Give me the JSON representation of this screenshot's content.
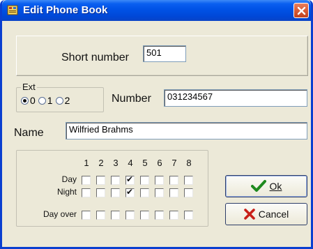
{
  "window": {
    "title": "Edit Phone Book",
    "icon": "phonebook-icon",
    "close_icon": "close-icon"
  },
  "short_number": {
    "label": "Short number",
    "value": "501"
  },
  "ext": {
    "legend": "Ext",
    "options": [
      {
        "label": "0",
        "checked": true
      },
      {
        "label": "1",
        "checked": false
      },
      {
        "label": "2",
        "checked": false
      }
    ]
  },
  "number": {
    "label": "Number",
    "value": "031234567"
  },
  "name": {
    "label": "Name",
    "value": "Wilfried Brahms"
  },
  "schedule": {
    "columns": [
      "1",
      "2",
      "3",
      "4",
      "5",
      "6",
      "7",
      "8"
    ],
    "rows": [
      {
        "label": "Day",
        "checked": [
          false,
          false,
          false,
          true,
          false,
          false,
          false,
          false
        ]
      },
      {
        "label": "Night",
        "checked": [
          false,
          false,
          false,
          true,
          false,
          false,
          false,
          false
        ]
      },
      {
        "label": "Day over",
        "checked": [
          false,
          false,
          false,
          false,
          false,
          false,
          false,
          false
        ]
      }
    ]
  },
  "buttons": {
    "ok": {
      "label": "Ok",
      "icon": "checkmark-icon",
      "icon_color": "#1f8a1f"
    },
    "cancel": {
      "label": "Cancel",
      "icon": "x-icon",
      "icon_color": "#c8201a"
    }
  },
  "colors": {
    "titlebar": "#0052e6",
    "face": "#ece9d8",
    "close": "#d95b35"
  }
}
